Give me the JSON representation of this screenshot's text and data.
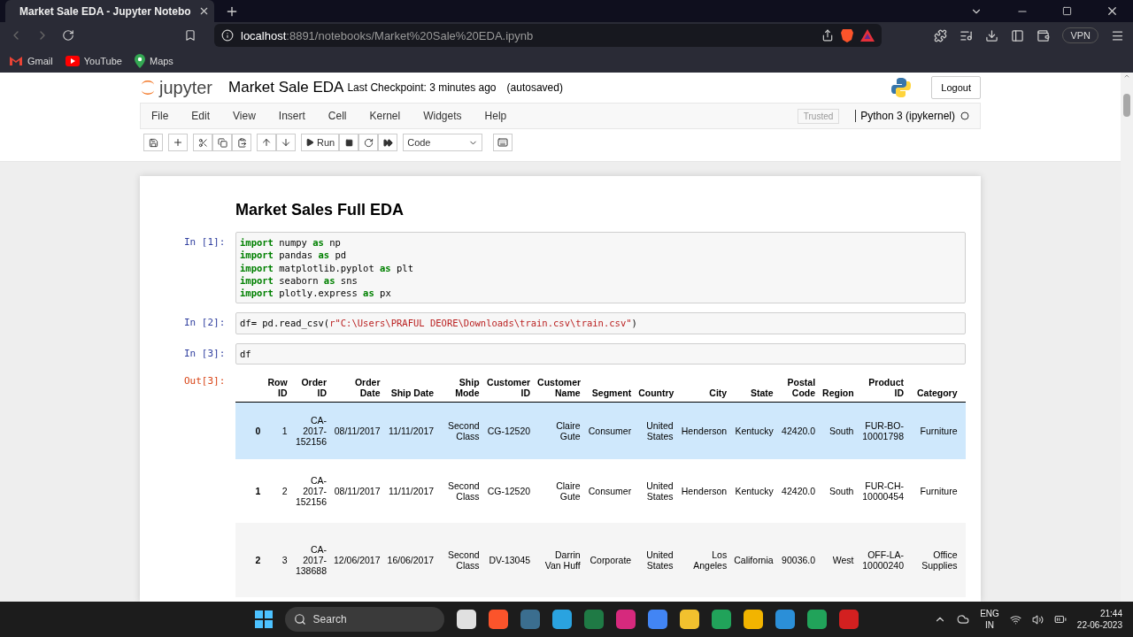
{
  "browser": {
    "tabs": [
      {
        "title": "Market Sale EDA - Jupyter Notebo",
        "selected": true
      }
    ],
    "url": "**localhost**:8891/notebooks/Market%20Sale%20EDA.ipynb",
    "vpn": "VPN",
    "bookmarks": [
      {
        "label": "Gmail",
        "kind": "gmail"
      },
      {
        "label": "YouTube",
        "kind": "youtube"
      },
      {
        "label": "Maps",
        "kind": "maps"
      }
    ]
  },
  "notebook": {
    "logo": "jupyter",
    "title": "Market Sale EDA",
    "checkpoint": "Last Checkpoint: 3 minutes ago",
    "autosave": "(autosaved)",
    "logout": "Logout",
    "menu": [
      "File",
      "Edit",
      "View",
      "Insert",
      "Cell",
      "Kernel",
      "Widgets",
      "Help"
    ],
    "trusted": "Trusted",
    "kernel": "Python 3 (ipykernel)",
    "run": "Run",
    "cell_type": "Code"
  },
  "cells": [
    {
      "kind": "markdown",
      "text": "Market Sales Full EDA"
    },
    {
      "kind": "code",
      "prompt": "In [1]:",
      "lines": [
        [
          {
            "kind": "keyword",
            "text": "import"
          },
          {
            "kind": "plain",
            "text": " numpy "
          },
          {
            "kind": "keyword",
            "text": "as"
          },
          {
            "kind": "plain",
            "text": " np"
          }
        ],
        [
          {
            "kind": "keyword",
            "text": "import"
          },
          {
            "kind": "plain",
            "text": " pandas "
          },
          {
            "kind": "keyword",
            "text": "as"
          },
          {
            "kind": "plain",
            "text": " pd"
          }
        ],
        [
          {
            "kind": "keyword",
            "text": "import"
          },
          {
            "kind": "plain",
            "text": " matplotlib.pyplot "
          },
          {
            "kind": "keyword",
            "text": "as"
          },
          {
            "kind": "plain",
            "text": " plt"
          }
        ],
        [
          {
            "kind": "keyword",
            "text": "import"
          },
          {
            "kind": "plain",
            "text": " seaborn "
          },
          {
            "kind": "keyword",
            "text": "as"
          },
          {
            "kind": "plain",
            "text": " sns"
          }
        ],
        [
          {
            "kind": "keyword",
            "text": "import"
          },
          {
            "kind": "plain",
            "text": " plotly.express "
          },
          {
            "kind": "keyword",
            "text": "as"
          },
          {
            "kind": "plain",
            "text": " px"
          }
        ]
      ]
    },
    {
      "kind": "code",
      "prompt": "In [2]:",
      "lines": [
        [
          {
            "kind": "plain",
            "text": "df= pd.read_csv("
          },
          {
            "kind": "string",
            "text": "r\"C:\\Users\\PRAFUL DEORE\\Downloads\\train.csv\\train.csv\""
          },
          {
            "kind": "plain",
            "text": ")"
          }
        ]
      ]
    },
    {
      "kind": "code",
      "prompt": "In [3]:",
      "lines": [
        [
          {
            "kind": "plain",
            "text": "df"
          }
        ]
      ]
    },
    {
      "kind": "table",
      "prompt": "Out[3]:",
      "columns": [
        "Row ID",
        "Order ID",
        "Order Date",
        "Ship Date",
        "Ship Mode",
        "Customer ID",
        "Customer Name",
        "Segment",
        "Country",
        "City",
        "State",
        "Postal Code",
        "Region",
        "Product ID",
        "Category"
      ],
      "rows": [
        {
          "index": "0",
          "selected": true,
          "cells": [
            "1",
            "CA-2017-152156",
            "08/11/2017",
            "11/11/2017",
            "Second Class",
            "CG-12520",
            "Claire Gute",
            "Consumer",
            "United States",
            "Henderson",
            "Kentucky",
            "42420.0",
            "South",
            "FUR-BO-10001798",
            "Furniture"
          ]
        },
        {
          "index": "1",
          "selected": false,
          "cells": [
            "2",
            "CA-2017-152156",
            "08/11/2017",
            "11/11/2017",
            "Second Class",
            "CG-12520",
            "Claire Gute",
            "Consumer",
            "United States",
            "Henderson",
            "Kentucky",
            "42420.0",
            "South",
            "FUR-CH-10000454",
            "Furniture"
          ]
        },
        {
          "index": "2",
          "selected": false,
          "cells": [
            "3",
            "CA-2017-138688",
            "12/06/2017",
            "16/06/2017",
            "Second Class",
            "DV-13045",
            "Darrin Van Huff",
            "Corporate",
            "United States",
            "Los Angeles",
            "California",
            "90036.0",
            "West",
            "OFF-LA-10000240",
            "Office Supplies"
          ]
        }
      ]
    }
  ],
  "taskbar": {
    "search": "Search",
    "language": "ENG",
    "region": "IN",
    "time": "21:44",
    "date": "22-06-2023"
  }
}
